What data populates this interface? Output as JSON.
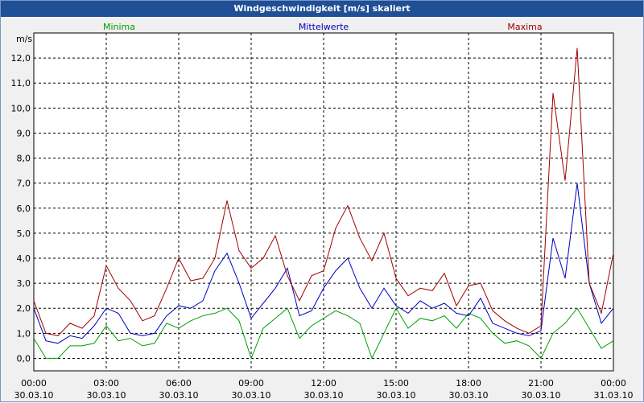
{
  "window": {
    "title": "Windgeschwindigkeit [m/s] skaliert"
  },
  "chart_data": {
    "type": "line",
    "title": "Windgeschwindigkeit [m/s] skaliert",
    "ylabel": "m/s",
    "ylim": [
      -0.5,
      13.0
    ],
    "grid": true,
    "legend_position": "top",
    "x_ticks": [
      {
        "top": "00:00",
        "bottom": "30.03.10"
      },
      {
        "top": "03:00",
        "bottom": "30.03.10"
      },
      {
        "top": "06:00",
        "bottom": "30.03.10"
      },
      {
        "top": "09:00",
        "bottom": "30.03.10"
      },
      {
        "top": "12:00",
        "bottom": "30.03.10"
      },
      {
        "top": "15:00",
        "bottom": "30.03.10"
      },
      {
        "top": "18:00",
        "bottom": "30.03.10"
      },
      {
        "top": "21:00",
        "bottom": "30.03.10"
      },
      {
        "top": "00:00",
        "bottom": "31.03.10"
      }
    ],
    "y_ticks": [
      "0,0",
      "1,0",
      "2,0",
      "3,0",
      "4,0",
      "5,0",
      "6,0",
      "7,0",
      "8,0",
      "9,0",
      "10,0",
      "11,0",
      "12,0"
    ],
    "x_hours": [
      0,
      0.5,
      1,
      1.5,
      2,
      2.5,
      3,
      3.5,
      4,
      4.5,
      5,
      5.5,
      6,
      6.5,
      7,
      7.5,
      8,
      8.5,
      9,
      9.5,
      10,
      10.5,
      11,
      11.5,
      12,
      12.5,
      13,
      13.5,
      14,
      14.5,
      15,
      15.5,
      16,
      16.5,
      17,
      17.5,
      18,
      18.5,
      19,
      19.5,
      20,
      20.5,
      21,
      21.5,
      22,
      22.5,
      23,
      23.5,
      24
    ],
    "series": [
      {
        "name": "Minima",
        "color": "#00a000",
        "values": [
          0.8,
          0.0,
          0.0,
          0.5,
          0.5,
          0.6,
          1.3,
          0.7,
          0.8,
          0.5,
          0.6,
          1.4,
          1.2,
          1.5,
          1.7,
          1.8,
          2.0,
          1.5,
          0.0,
          1.2,
          1.6,
          2.0,
          0.8,
          1.3,
          1.6,
          1.9,
          1.7,
          1.4,
          0.0,
          1.0,
          2.0,
          1.2,
          1.6,
          1.5,
          1.7,
          1.2,
          1.8,
          1.6,
          1.0,
          0.6,
          0.7,
          0.5,
          0.0,
          1.0,
          1.4,
          2.0,
          1.2,
          0.4,
          0.7
        ]
      },
      {
        "name": "Mittelwerte",
        "color": "#0000c0",
        "values": [
          2.0,
          0.7,
          0.6,
          0.9,
          0.8,
          1.3,
          2.0,
          1.8,
          1.0,
          0.9,
          1.0,
          1.7,
          2.1,
          2.0,
          2.3,
          3.5,
          4.2,
          3.0,
          1.6,
          2.2,
          2.8,
          3.6,
          1.7,
          1.9,
          2.8,
          3.5,
          4.0,
          2.8,
          2.0,
          2.8,
          2.1,
          1.8,
          2.3,
          2.0,
          2.2,
          1.8,
          1.7,
          2.4,
          1.4,
          1.2,
          1.0,
          0.9,
          1.1,
          4.8,
          3.2,
          7.0,
          3.0,
          1.4,
          2.0
        ]
      },
      {
        "name": "Maxima",
        "color": "#a00000",
        "values": [
          2.3,
          1.0,
          0.9,
          1.4,
          1.2,
          1.7,
          3.7,
          2.8,
          2.3,
          1.5,
          1.7,
          2.8,
          4.0,
          3.1,
          3.2,
          4.0,
          6.3,
          4.3,
          3.6,
          4.0,
          4.9,
          3.3,
          2.3,
          3.3,
          3.5,
          5.2,
          6.1,
          4.8,
          3.9,
          5.0,
          3.2,
          2.5,
          2.8,
          2.7,
          3.4,
          2.1,
          2.9,
          3.0,
          1.9,
          1.5,
          1.2,
          1.0,
          1.3,
          10.6,
          7.1,
          12.4,
          3.0,
          1.8,
          4.2
        ]
      }
    ]
  }
}
